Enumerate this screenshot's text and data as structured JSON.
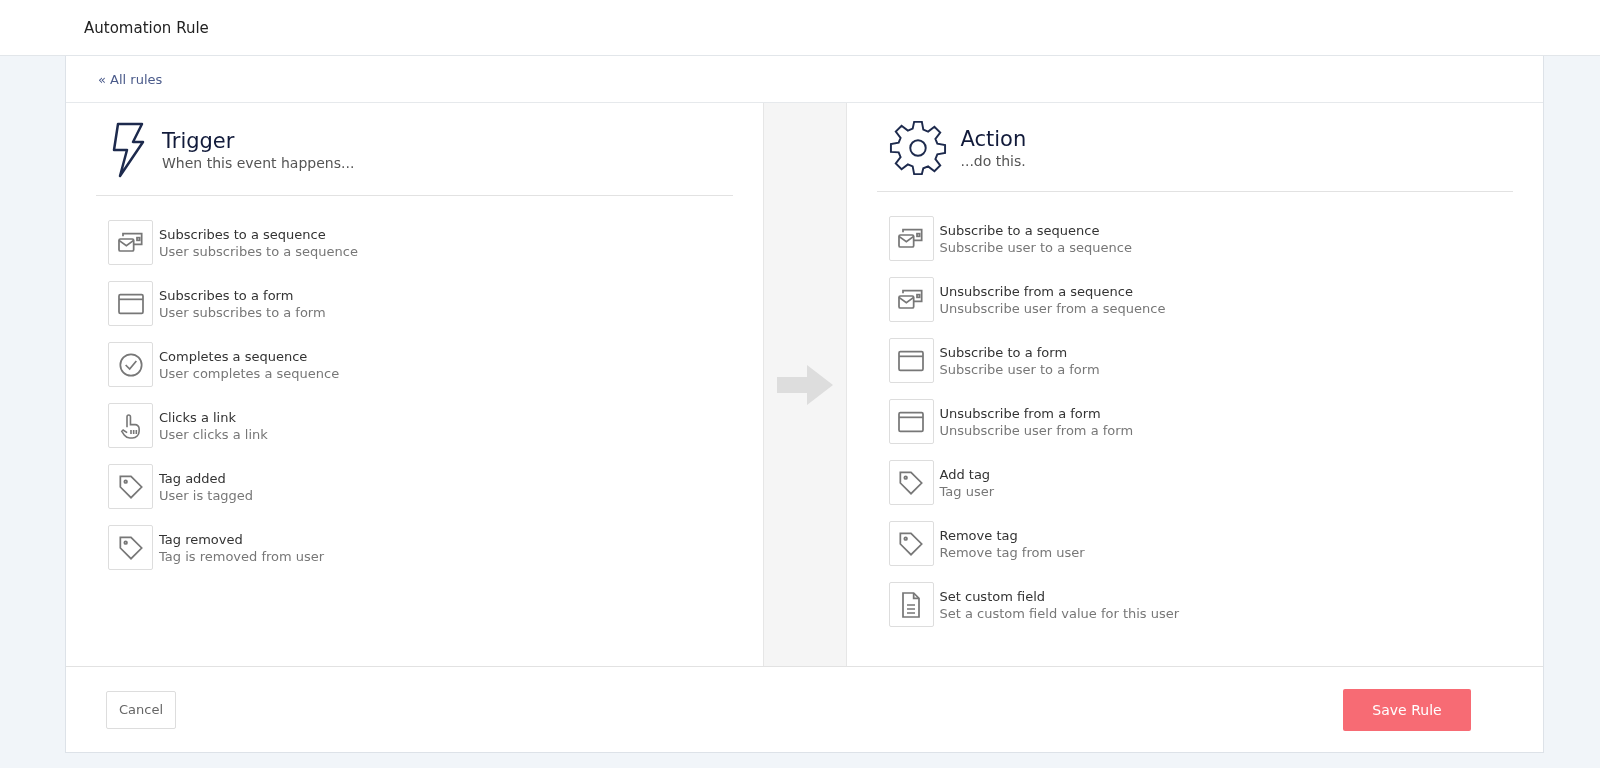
{
  "header": {
    "title": "Automation Rule"
  },
  "back_link": "« All rules",
  "trigger": {
    "title": "Trigger",
    "subtitle": "When this event happens...",
    "items": [
      {
        "kind": "sequence",
        "title": "Subscribes to a sequence",
        "description": "User subscribes to a sequence"
      },
      {
        "kind": "form",
        "title": "Subscribes to a form",
        "description": "User subscribes to a form"
      },
      {
        "kind": "check",
        "title": "Completes a sequence",
        "description": "User completes a sequence"
      },
      {
        "kind": "pointer",
        "title": "Clicks a link",
        "description": "User clicks a link"
      },
      {
        "kind": "tag",
        "title": "Tag added",
        "description": "User is tagged"
      },
      {
        "kind": "tag",
        "title": "Tag removed",
        "description": "Tag is removed from user"
      }
    ]
  },
  "action": {
    "title": "Action",
    "subtitle": "...do this.",
    "items": [
      {
        "kind": "sequence",
        "title": "Subscribe to a sequence",
        "description": "Subscribe user to a sequence"
      },
      {
        "kind": "sequence",
        "title": "Unsubscribe from a sequence",
        "description": "Unsubscribe user from a sequence"
      },
      {
        "kind": "form",
        "title": "Subscribe to a form",
        "description": "Subscribe user to a form"
      },
      {
        "kind": "form",
        "title": "Unsubscribe from a form",
        "description": "Unsubscribe user from a form"
      },
      {
        "kind": "tag",
        "title": "Add tag",
        "description": "Tag user"
      },
      {
        "kind": "tag",
        "title": "Remove tag",
        "description": "Remove tag from user"
      },
      {
        "kind": "document",
        "title": "Set custom field",
        "description": "Set a custom field value for this user"
      }
    ]
  },
  "footer": {
    "cancel": "Cancel",
    "save": "Save Rule"
  }
}
